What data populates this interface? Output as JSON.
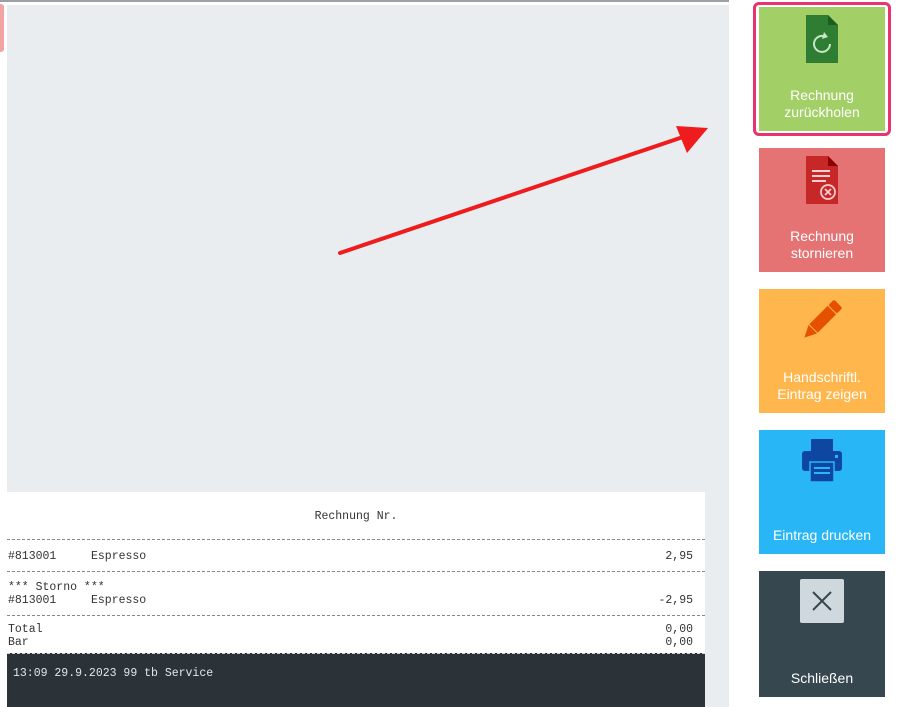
{
  "receipt": {
    "title": "Rechnung Nr.",
    "line1": {
      "code": "#813001",
      "item": "Espresso",
      "amount": "2,95"
    },
    "storno_label": "*** Storno ***",
    "line2": {
      "code": "#813001",
      "item": "Espresso",
      "amount": "-2,95"
    },
    "total_label": "Total",
    "total_value": "0,00",
    "bar_label": "Bar",
    "bar_value": "0,00",
    "footer": "13:09 29.9.2023 99 tb Service"
  },
  "actions": {
    "recall": {
      "line1": "Rechnung",
      "line2": "zurückholen",
      "icon": "document-recall-icon"
    },
    "cancel": {
      "line1": "Rechnung",
      "line2": "stornieren",
      "icon": "document-cancel-icon"
    },
    "handwritten": {
      "line1": "Handschriftl.",
      "line2": "Eintrag zeigen",
      "icon": "pencil-icon"
    },
    "print": {
      "label": "Eintrag drucken",
      "icon": "printer-icon"
    },
    "close": {
      "label": "Schließen",
      "icon": "close-icon"
    }
  },
  "colors": {
    "recall": "#a2cf66",
    "cancel": "#e57373",
    "handwritten": "#ffb74d",
    "print": "#29b6f6",
    "close": "#37474f",
    "highlight": "#e8336e",
    "arrow": "#ee1c1c"
  }
}
